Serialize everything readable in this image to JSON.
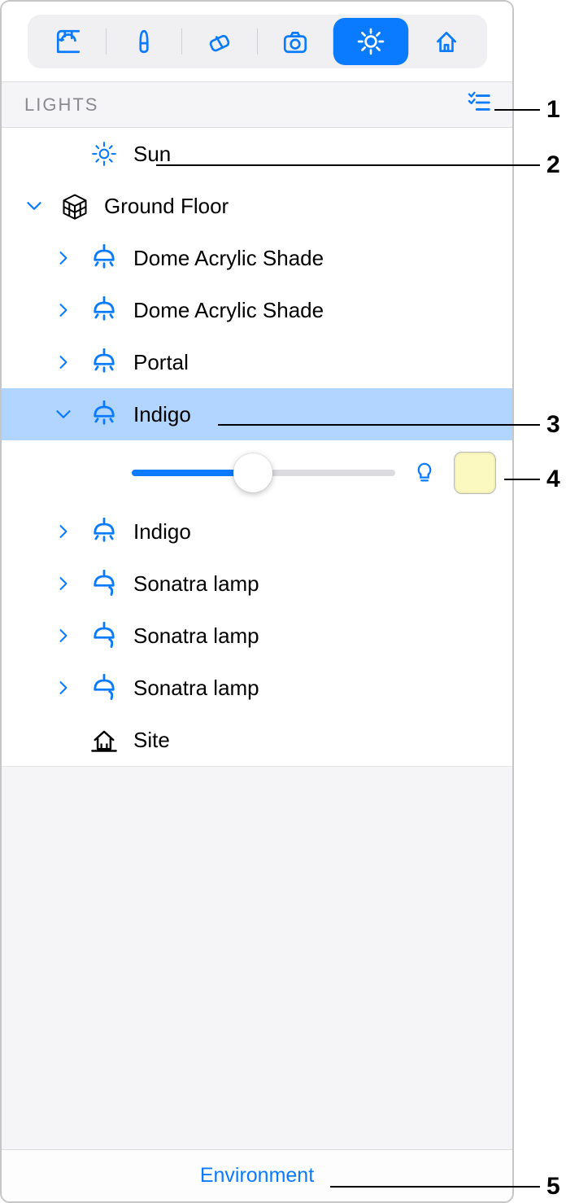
{
  "toolbar": {
    "buttons": [
      "measure",
      "brush",
      "eraser",
      "camera",
      "light",
      "house"
    ],
    "active_index": 4
  },
  "section": {
    "title": "LIGHTS"
  },
  "items": {
    "sun": "Sun",
    "ground_floor": "Ground Floor",
    "dome1": "Dome Acrylic Shade",
    "dome2": "Dome Acrylic Shade",
    "portal": "Portal",
    "indigo1": "Indigo",
    "indigo2": "Indigo",
    "sonatra1": "Sonatra lamp",
    "sonatra2": "Sonatra lamp",
    "sonatra3": "Sonatra lamp",
    "site": "Site"
  },
  "slider": {
    "value_percent": 46,
    "color_hex": "#fbf8c0"
  },
  "footer": {
    "link": "Environment"
  },
  "callouts": {
    "c1": "1",
    "c2": "2",
    "c3": "3",
    "c4": "4",
    "c5": "5"
  },
  "colors": {
    "accent": "#0a7bff",
    "selection": "#b1d5ff"
  }
}
